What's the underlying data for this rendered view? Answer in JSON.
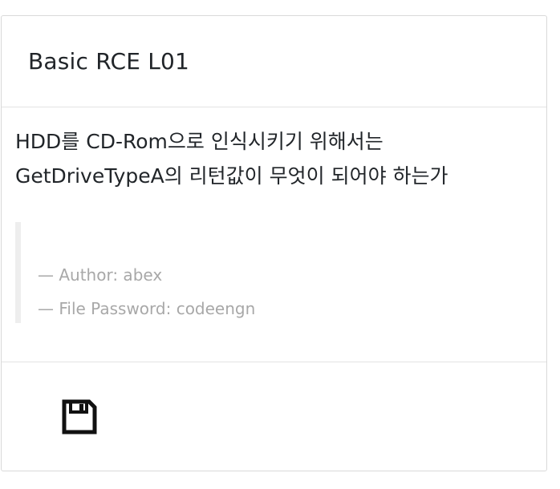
{
  "card": {
    "title": "Basic RCE L01",
    "description_lines": [
      "HDD를 CD-Rom으로 인식시키기 위해서는",
      "GetDriveTypeA의 리턴값이 무엇이 되어야 하는가"
    ],
    "meta": {
      "author": "— Author: abex",
      "password": "— File Password: codeengn"
    },
    "footer": {
      "download_icon": "floppy-disk-icon"
    }
  }
}
